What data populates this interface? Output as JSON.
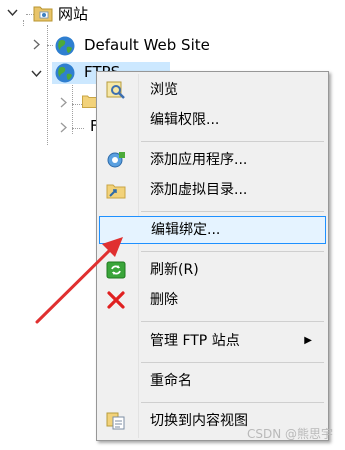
{
  "tree": {
    "root_label": "网站",
    "items": [
      {
        "label": "Default Web Site"
      },
      {
        "label": "FTPS",
        "selected": true
      }
    ],
    "child_partial_label": "F"
  },
  "context_menu": {
    "items": [
      {
        "label": "浏览",
        "icon": "browse-icon"
      },
      {
        "label": "编辑权限...",
        "icon": ""
      },
      {
        "label": "添加应用程序...",
        "icon": "add-application-icon"
      },
      {
        "label": "添加虚拟目录...",
        "icon": "add-virtual-directory-icon"
      },
      {
        "label": "编辑绑定...",
        "icon": "",
        "highlighted": true
      },
      {
        "label": "刷新(R)",
        "icon": "refresh-icon"
      },
      {
        "label": "删除",
        "icon": "delete-icon"
      },
      {
        "label": "管理 FTP 站点",
        "icon": "",
        "submenu": "▶"
      },
      {
        "label": "重命名",
        "icon": ""
      },
      {
        "label": "切换到内容视图",
        "icon": "content-view-icon"
      }
    ]
  },
  "colors": {
    "selection": "#cce8ff",
    "menu_highlight_bg": "#e5f3ff",
    "menu_highlight_border": "#1e90ff",
    "arrow": "#e03030"
  },
  "watermark": "CSDN @熊思宇"
}
